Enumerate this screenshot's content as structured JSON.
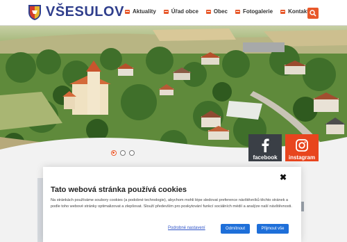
{
  "header": {
    "brand": "VŠESULOV",
    "nav": [
      "Aktuality",
      "Úřad obce",
      "Obec",
      "Fotogalerie",
      "Kontakt"
    ]
  },
  "hero": {
    "slides": 3,
    "active_slide": 1
  },
  "social": {
    "facebook_label": "facebook",
    "instagram_label": "instagram"
  },
  "cookie": {
    "title": "Tato webová stránka používá cookies",
    "text": "Na stránkách používáme soubory cookies (a podobné technologie), abychom mohli lépe sledovat preference návštěvníků těchto stránek a podle toho webové stránky optimalizovat a zlepšovat. Slouží především pro poskytování funkcí sociálních médií a analýze naší návštěvnosti.",
    "settings_link": "Podrobné nastavení",
    "reject_label": "Odmítnout",
    "accept_label": "Přijmout vše",
    "close_glyph": "✖"
  },
  "colors": {
    "accent": "#e8582a",
    "brand": "#2f3e8c",
    "button": "#1e6fd9"
  }
}
